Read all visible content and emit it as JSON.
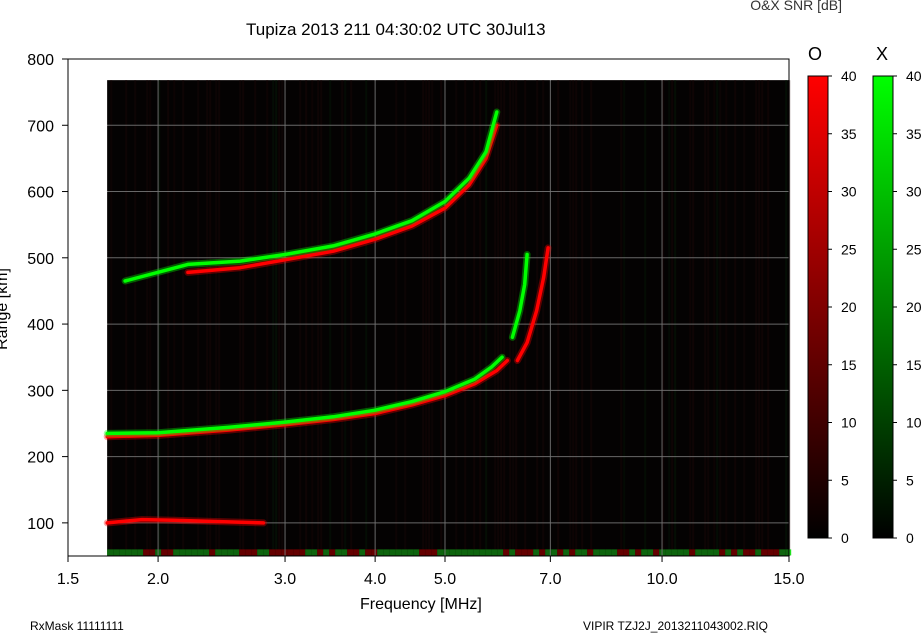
{
  "header": {
    "title": "Tupiza 2013 211 04:30:02 UTC       30Jul13",
    "snr_label": "O&X SNR [dB]"
  },
  "footer": {
    "rxmask": "RxMask 11111111",
    "filename": "VIPIR  TZJ2J_2013211043002.RIQ"
  },
  "colorbars": {
    "o_label": "O",
    "x_label": "X",
    "o_color": "#ff0000",
    "x_color": "#00ff00",
    "ticks": [
      "0",
      "5",
      "10",
      "15",
      "20",
      "25",
      "30",
      "35",
      "40"
    ]
  },
  "chart_data": {
    "type": "heatmap",
    "title": "Tupiza 2013 211 04:30:02 UTC       30Jul13",
    "xlabel": "Frequency [MHz]",
    "ylabel": "Range [km]",
    "x_scale": "log",
    "xlim": [
      1.5,
      15.0
    ],
    "ylim": [
      50,
      800
    ],
    "x_ticks": [
      1.5,
      2.0,
      3.0,
      4.0,
      5.0,
      7.0,
      10.0,
      15.0
    ],
    "x_tick_labels": [
      "1.5",
      "2.0",
      "3.0",
      "4.0",
      "5.0",
      "7.0",
      "10.0",
      "15.0"
    ],
    "y_ticks": [
      100,
      200,
      300,
      400,
      500,
      600,
      700,
      800
    ],
    "y_tick_labels": [
      "100",
      "200",
      "300",
      "400",
      "500",
      "600",
      "700",
      "800"
    ],
    "grid": true,
    "data_x_range": [
      1.7,
      15.0
    ],
    "data_y_range": [
      50,
      768
    ],
    "colorscale_range": [
      0,
      40
    ],
    "series": [
      {
        "name": "O",
        "color": "#ff0000",
        "points": [
          [
            1.7,
            230
          ],
          [
            2.0,
            232
          ],
          [
            2.5,
            240
          ],
          [
            3.0,
            248
          ],
          [
            3.5,
            256
          ],
          [
            4.0,
            265
          ],
          [
            4.5,
            278
          ],
          [
            5.0,
            292
          ],
          [
            5.5,
            310
          ],
          [
            5.9,
            330
          ],
          [
            6.1,
            345
          ]
        ]
      },
      {
        "name": "X",
        "color": "#00ff00",
        "points": [
          [
            1.7,
            235
          ],
          [
            2.0,
            236
          ],
          [
            2.5,
            244
          ],
          [
            3.0,
            252
          ],
          [
            3.5,
            260
          ],
          [
            4.0,
            270
          ],
          [
            4.5,
            283
          ],
          [
            5.0,
            298
          ],
          [
            5.5,
            317
          ],
          [
            5.8,
            335
          ],
          [
            6.0,
            350
          ]
        ]
      },
      {
        "name": "O",
        "color": "#ff0000",
        "points": [
          [
            2.2,
            478
          ],
          [
            2.6,
            485
          ],
          [
            3.0,
            497
          ],
          [
            3.5,
            510
          ],
          [
            4.0,
            528
          ],
          [
            4.5,
            548
          ],
          [
            5.0,
            575
          ],
          [
            5.4,
            610
          ],
          [
            5.7,
            650
          ],
          [
            5.9,
            700
          ]
        ]
      },
      {
        "name": "X",
        "color": "#00ff00",
        "points": [
          [
            1.8,
            465
          ],
          [
            2.2,
            490
          ],
          [
            2.6,
            495
          ],
          [
            3.0,
            505
          ],
          [
            3.5,
            518
          ],
          [
            4.0,
            536
          ],
          [
            4.5,
            556
          ],
          [
            5.0,
            585
          ],
          [
            5.4,
            620
          ],
          [
            5.7,
            660
          ],
          [
            5.9,
            720
          ]
        ]
      },
      {
        "name": "O",
        "color": "#ff0000",
        "points": [
          [
            6.3,
            345
          ],
          [
            6.5,
            372
          ],
          [
            6.7,
            420
          ],
          [
            6.85,
            470
          ],
          [
            6.95,
            515
          ]
        ]
      },
      {
        "name": "X",
        "color": "#00ff00",
        "points": [
          [
            6.2,
            380
          ],
          [
            6.35,
            420
          ],
          [
            6.45,
            460
          ],
          [
            6.5,
            505
          ]
        ]
      },
      {
        "name": "O",
        "color": "#ff0000",
        "points": [
          [
            1.7,
            100
          ],
          [
            1.9,
            105
          ],
          [
            2.1,
            104
          ],
          [
            2.4,
            102
          ],
          [
            2.8,
            100
          ]
        ]
      }
    ]
  }
}
